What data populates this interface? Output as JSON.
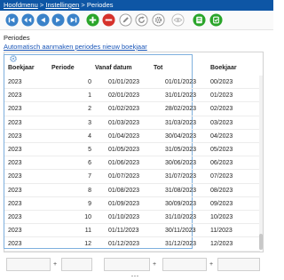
{
  "breadcrumb": {
    "home": "Hoofdmenu",
    "sep1": ">",
    "settings": "Instellingen",
    "sep2": ">",
    "current": "Periodes"
  },
  "toolbar": [
    {
      "name": "first-icon"
    },
    {
      "name": "previous-icon"
    },
    {
      "name": "play-previous-icon"
    },
    {
      "name": "play-next-icon"
    },
    {
      "name": "last-icon"
    },
    {
      "name": "add-icon"
    },
    {
      "name": "remove-icon"
    },
    {
      "name": "edit-icon"
    },
    {
      "name": "refresh-icon"
    },
    {
      "name": "view-icon"
    },
    {
      "name": "export-icon"
    },
    {
      "name": "settings-icon"
    }
  ],
  "page": {
    "title": "Periodes",
    "auto_link": "Automatisch aanmaken periodes nieuw boekjaar"
  },
  "table": {
    "columns": [
      "Boekjaar",
      "Periode",
      "Vanaf datum",
      "Tot",
      "Boekjaar"
    ],
    "rows": [
      [
        "2023",
        "0",
        "01/01/2023",
        "01/01/2023",
        "00/2023"
      ],
      [
        "2023",
        "1",
        "02/01/2023",
        "31/01/2023",
        "01/2023"
      ],
      [
        "2023",
        "2",
        "01/02/2023",
        "28/02/2023",
        "02/2023"
      ],
      [
        "2023",
        "3",
        "01/03/2023",
        "31/03/2023",
        "03/2023"
      ],
      [
        "2023",
        "4",
        "01/04/2023",
        "30/04/2023",
        "04/2023"
      ],
      [
        "2023",
        "5",
        "01/05/2023",
        "31/05/2023",
        "05/2023"
      ],
      [
        "2023",
        "6",
        "01/06/2023",
        "30/06/2023",
        "06/2023"
      ],
      [
        "2023",
        "7",
        "01/07/2023",
        "31/07/2023",
        "07/2023"
      ],
      [
        "2023",
        "8",
        "01/08/2023",
        "31/08/2023",
        "08/2023"
      ],
      [
        "2023",
        "9",
        "01/09/2023",
        "30/09/2023",
        "09/2023"
      ],
      [
        "2023",
        "10",
        "01/10/2023",
        "31/10/2023",
        "10/2023"
      ],
      [
        "2023",
        "11",
        "01/11/2023",
        "30/11/2023",
        "11/2023"
      ],
      [
        "2023",
        "12",
        "01/12/2023",
        "31/12/2023",
        "12/2023"
      ]
    ]
  },
  "footer": {
    "sep1": "+",
    "sep2": "+",
    "sep3": "+"
  },
  "colors": {
    "topbar": "#0e56a5",
    "toolbar_icon": "#3a82c9",
    "add": "#2aa52a",
    "remove": "#d6322b",
    "export": "#2aa52a",
    "link": "#1a56b8"
  }
}
